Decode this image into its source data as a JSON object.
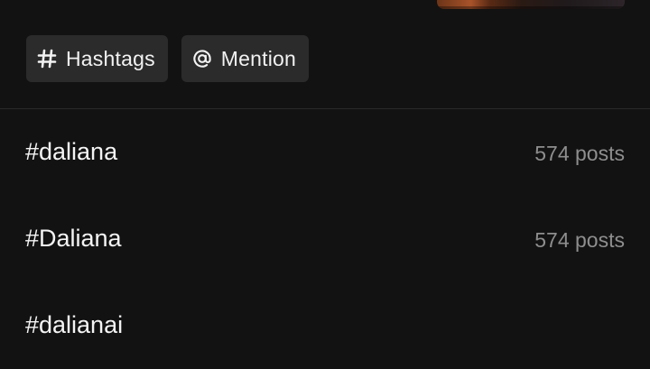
{
  "filters": {
    "hashtags_label": "Hashtags",
    "mention_label": "Mention"
  },
  "results": [
    {
      "tag": "#daliana",
      "count": "574 posts"
    },
    {
      "tag": "#Daliana",
      "count": "574 posts"
    },
    {
      "tag": "#dalianai",
      "count": ""
    }
  ],
  "icons": {
    "hashtag": "hash-icon",
    "mention": "at-sign-icon"
  },
  "colors": {
    "background": "#121212",
    "chip_background": "#2b2b2b",
    "secondary_text": "#8e8e8e"
  }
}
